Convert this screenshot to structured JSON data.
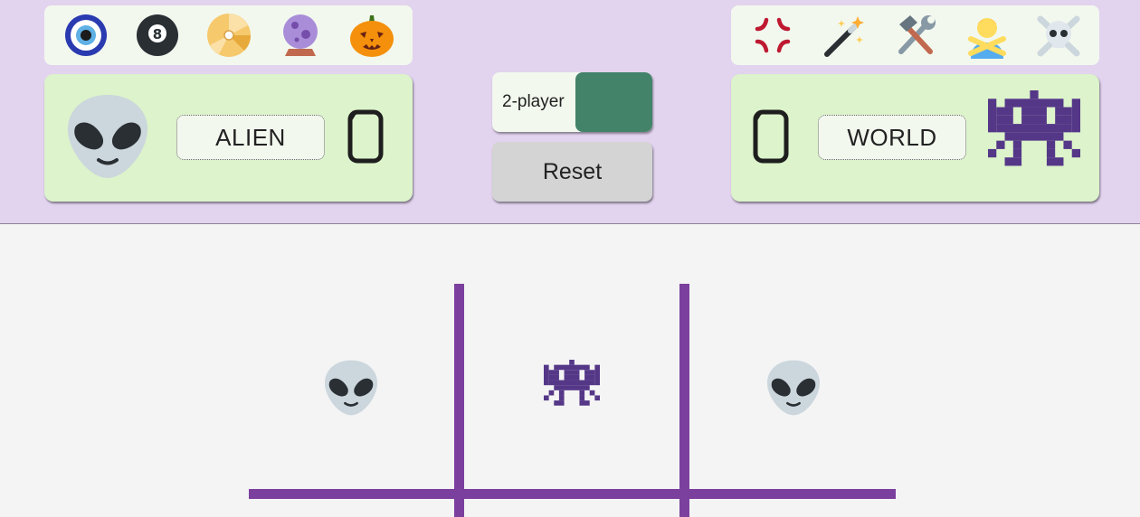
{
  "left_player": {
    "name": "ALIEN",
    "score": "0",
    "avatar": "alien-icon",
    "emoji_options": [
      "nazar-amulet-icon",
      "8-ball-icon",
      "dvd-icon",
      "crystal-ball-icon",
      "jack-o-lantern-icon"
    ]
  },
  "right_player": {
    "name": "WORLD",
    "score": "0",
    "avatar": "space-invader-icon",
    "emoji_options": [
      "anger-symbol-icon",
      "magic-wand-icon",
      "hammer-and-wrench-icon",
      "person-gesturing-no-icon",
      "skull-and-crossbones-icon"
    ]
  },
  "controls": {
    "mode_label": "2-player",
    "mode_color": "#42836a",
    "reset_label": "Reset"
  },
  "board": {
    "line_color": "#7b3f9e",
    "background": "#f4f4f4",
    "cells_visible": [
      {
        "row": 0,
        "col": 0,
        "mark": "alien-icon"
      },
      {
        "row": 0,
        "col": 1,
        "mark": "space-invader-icon"
      },
      {
        "row": 0,
        "col": 2,
        "mark": "alien-icon"
      }
    ]
  },
  "colors": {
    "header_bg": "#e2d3ef",
    "card_bg": "#dcf3cb",
    "emoji_bar_bg": "#f2f8ee"
  }
}
